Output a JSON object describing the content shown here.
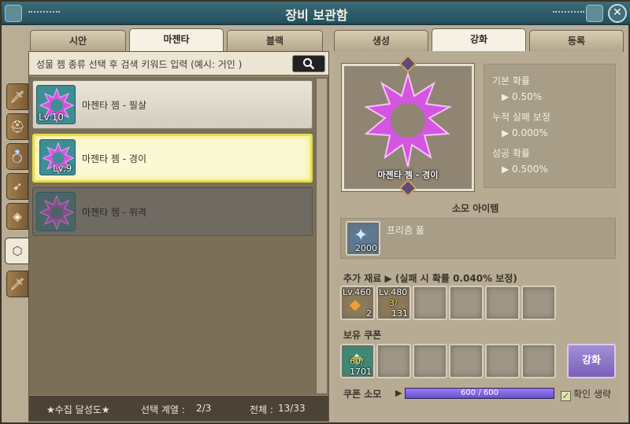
{
  "window": {
    "title": "장비 보관함"
  },
  "left_tabs": [
    "시안",
    "마젠타",
    "블랙"
  ],
  "left_active_tab": 1,
  "right_tabs": [
    "생성",
    "강화",
    "등록"
  ],
  "right_active_tab": 1,
  "search": {
    "hint": "성물 젬 종류 선택 후 검색 키워드 입력 (예시: 거인 )",
    "button_icon": "search-icon"
  },
  "side_tabs": [
    "sword-icon",
    "helmet-icon",
    "ring-icon",
    "wing-icon",
    "diamond-icon",
    "d20-icon",
    "sword-icon"
  ],
  "side_active_tab": 5,
  "gems": [
    {
      "level": "Lv.10",
      "name": "마젠타 젬 - 필살",
      "state": "normal"
    },
    {
      "level": "Lv.9",
      "name": "마젠타 젬 - 경이",
      "state": "selected"
    },
    {
      "level": "",
      "name": "마젠타 젬 - 위격",
      "state": "disabled"
    }
  ],
  "footer": {
    "collection": "★수집 달성도★",
    "selected_label": "선택 계열 :",
    "selected_value": "2/3",
    "total_label": "전체 :",
    "total_value": "13/33"
  },
  "detail": {
    "gem_caption": "마젠타 젬 - 경이",
    "base_prob_label": "기본 확률",
    "base_prob_value": "▶ 0.50%",
    "fail_bonus_label": "누적 실패 보정",
    "fail_bonus_value": "▶ 0.000%",
    "success_prob_label": "성공 확률",
    "success_prob_value": "▶ 0.500%"
  },
  "consume": {
    "heading": "소모 아이템",
    "item_name": "프리즘 풀",
    "item_count": "2000"
  },
  "extra": {
    "heading": "추가 재료 ▶ (실패 시 확률 0.040% 보정)",
    "slots": [
      {
        "level": "Lv.460",
        "count": "2",
        "ratio": ""
      },
      {
        "level": "Lv.480",
        "count": "131",
        "ratio": "3/"
      }
    ]
  },
  "coupon": {
    "heading": "보유 쿠폰",
    "slot_ratio": "60/",
    "slot_count": "1701",
    "consume_label": "쿠폰 소모",
    "bar_text": "600 / 600",
    "bar_fill": 1.0,
    "confirm_label": "확인 생략",
    "confirm_checked": true
  },
  "enhance_button": "강화",
  "colors": {
    "title_bar": "#2e5d69",
    "accent": "#7a5fb8",
    "gem": "#d455e0"
  }
}
